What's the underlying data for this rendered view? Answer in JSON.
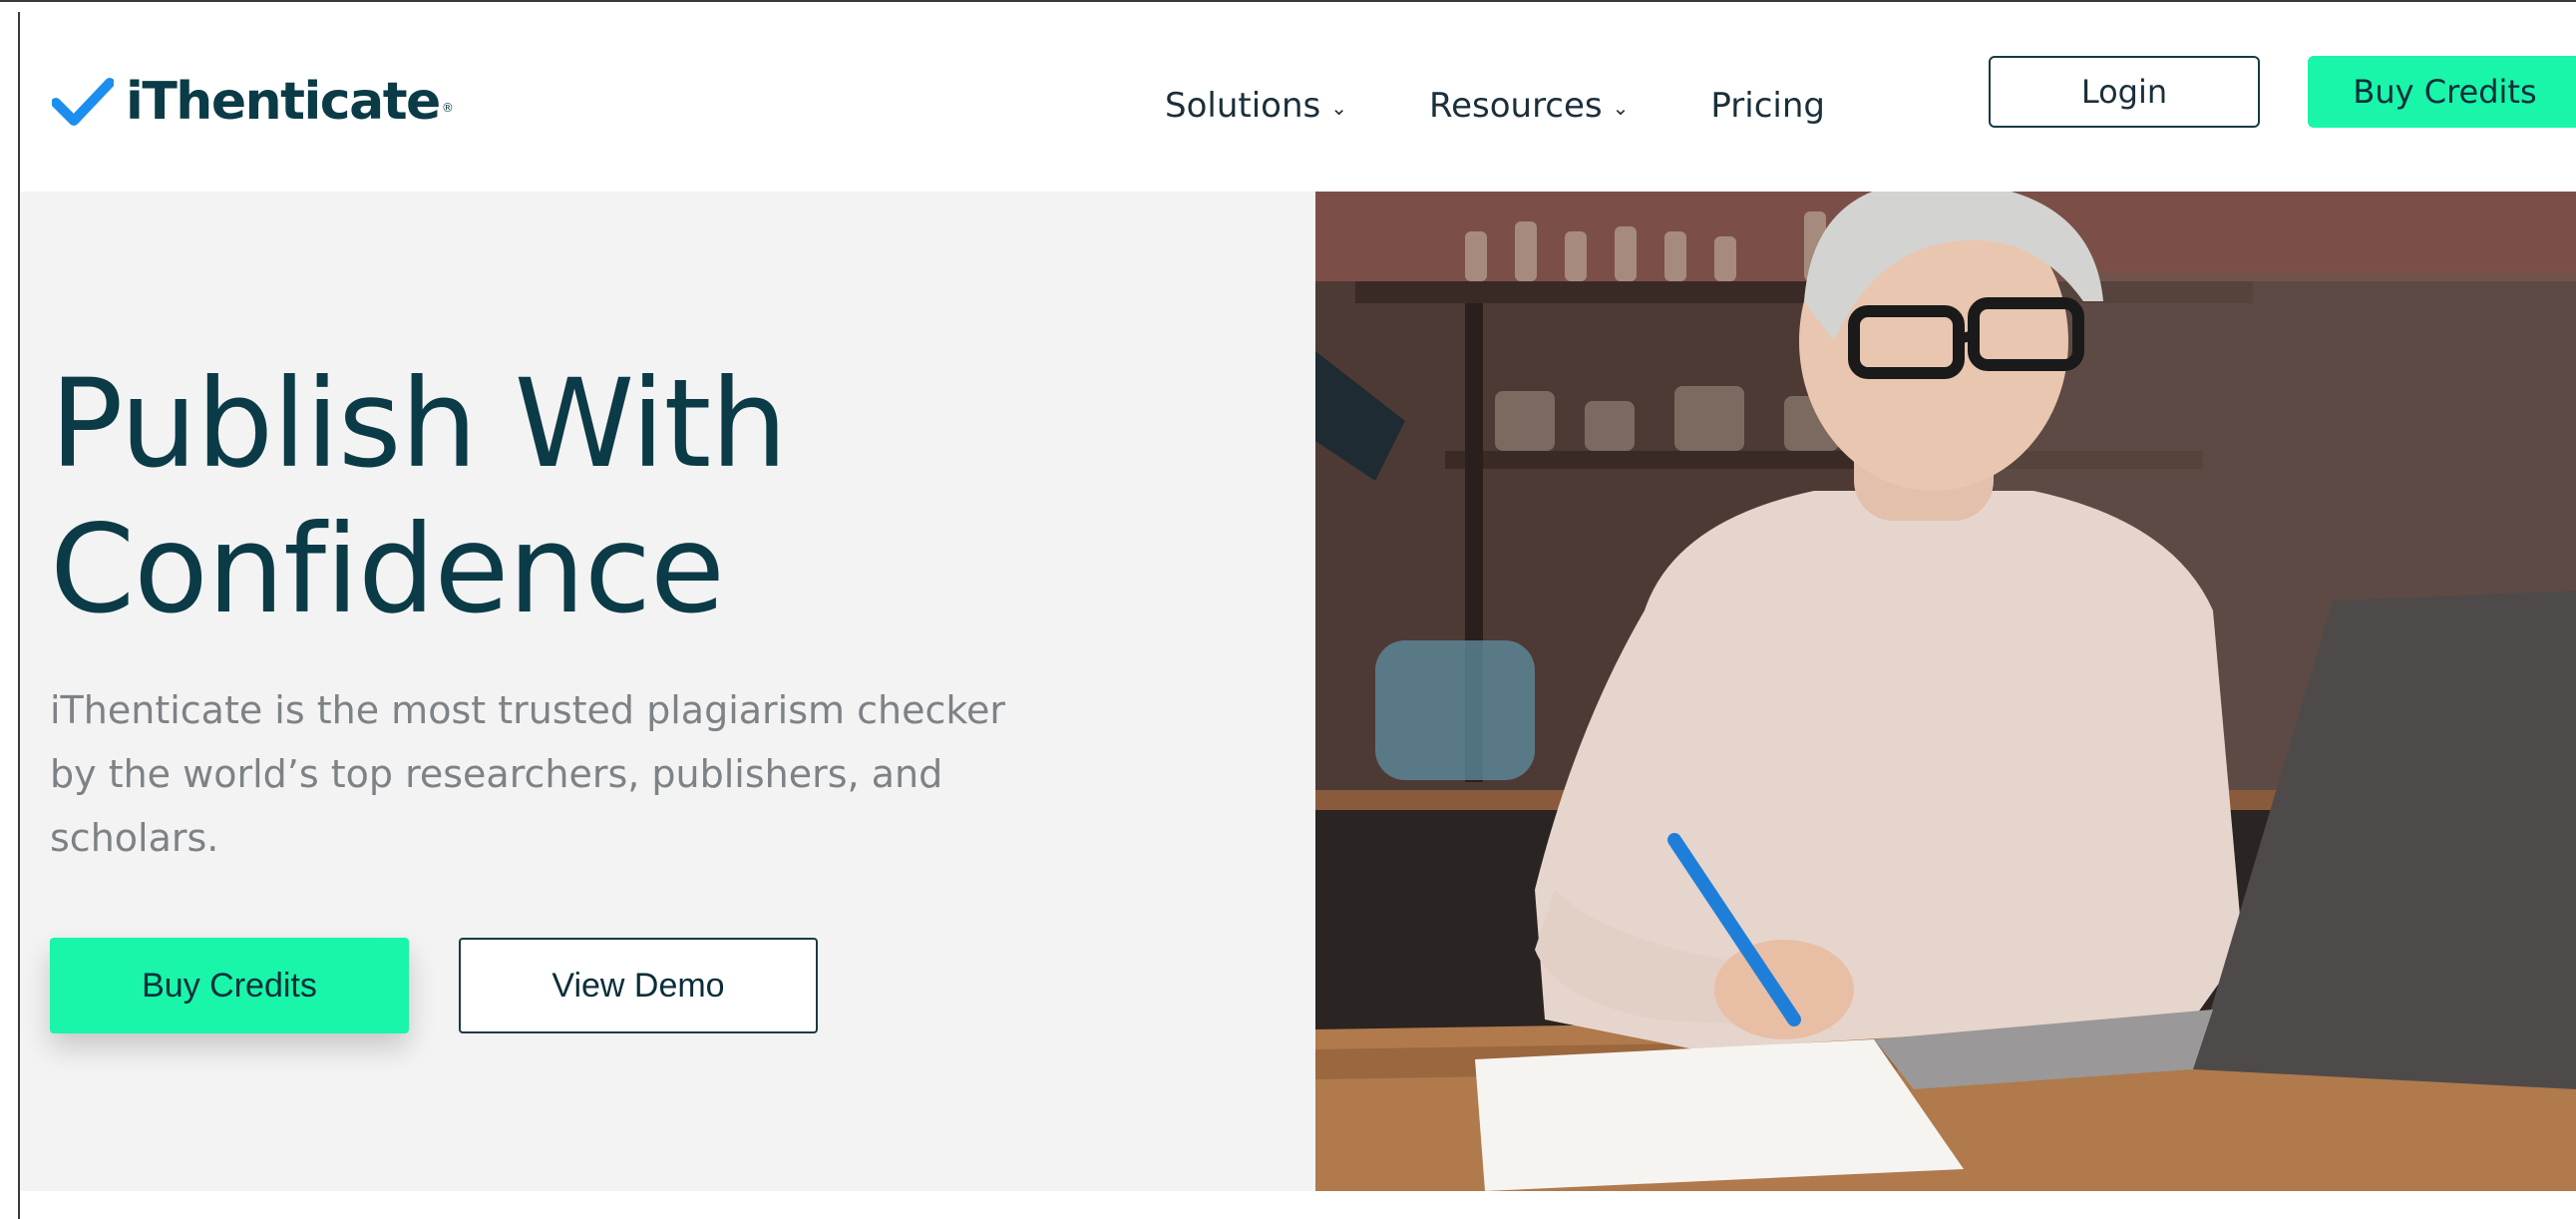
{
  "brand": {
    "name": "iThenticate",
    "registered_mark": "®",
    "accent_color": "#19f5a9",
    "text_color": "#0b3b47",
    "logo_icon": "checkmark-icon"
  },
  "nav": {
    "items": [
      {
        "label": "Solutions",
        "has_dropdown": true
      },
      {
        "label": "Resources",
        "has_dropdown": true
      },
      {
        "label": "Pricing",
        "has_dropdown": false
      }
    ],
    "chevron_glyph": "⌄"
  },
  "header_buttons": {
    "login": "Login",
    "buy_credits": "Buy Credits"
  },
  "hero": {
    "title_line1": "Publish With",
    "title_line2": "Confidence",
    "subtitle": "iThenticate is the most trusted plagiarism checker by the world’s top researchers, publishers, and scholars.",
    "primary_cta": "Buy Credits",
    "secondary_cta": "View Demo"
  },
  "hero_image": {
    "subject": "woman-writing-at-laptop-photo"
  }
}
